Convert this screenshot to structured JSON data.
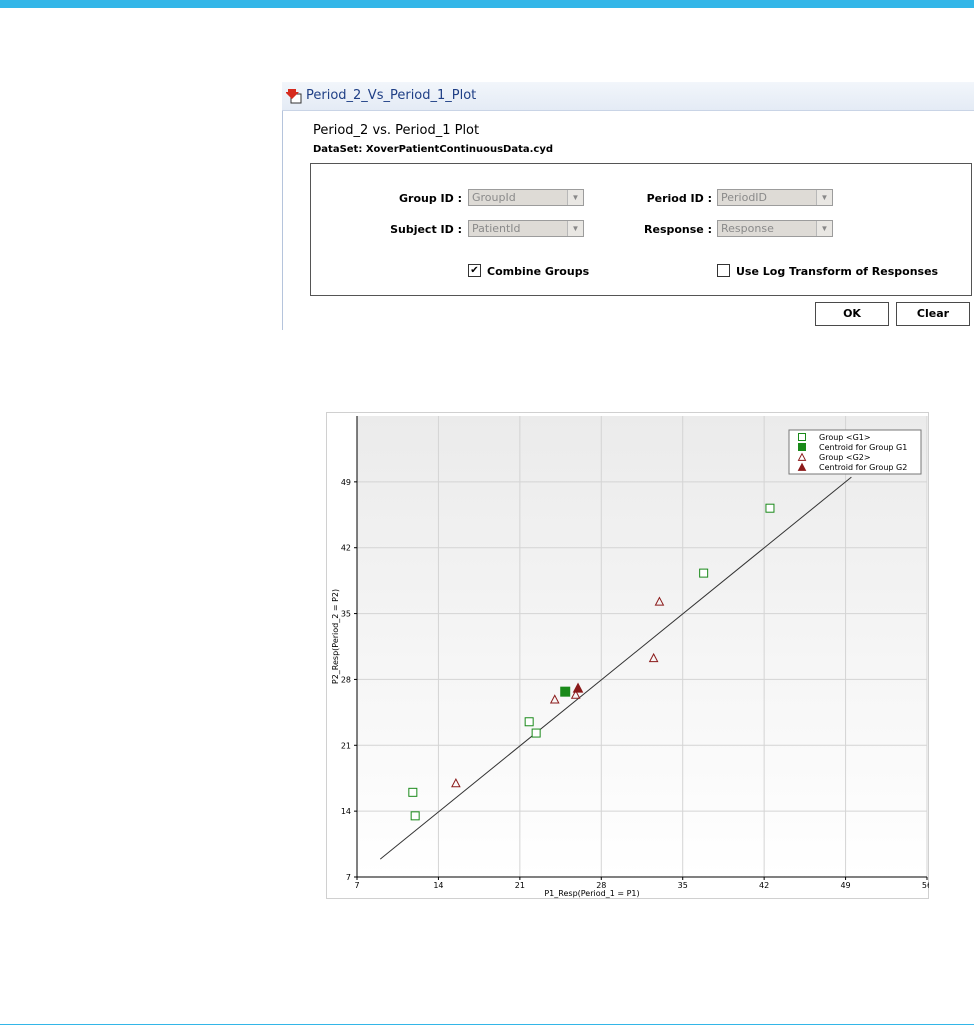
{
  "dialog": {
    "title": "Period_2_Vs_Period_1_Plot",
    "heading": "Period_2 vs. Period_1 Plot",
    "dataset": "DataSet: XoverPatientContinuousData.cyd"
  },
  "form": {
    "group_id": {
      "label": "Group ID :",
      "value": "GroupId"
    },
    "subject_id": {
      "label": "Subject ID :",
      "value": "PatientId"
    },
    "period_id": {
      "label": "Period ID :",
      "value": "PeriodID"
    },
    "response": {
      "label": "Response :",
      "value": "Response"
    },
    "combine_groups": {
      "label": "Combine Groups",
      "checked": true,
      "mark": "✔"
    },
    "log_transform": {
      "label": "Use Log Transform of Responses",
      "checked": false,
      "mark": ""
    }
  },
  "buttons": {
    "ok": "OK",
    "clear": "Clear"
  },
  "icons": {
    "title": "red-down-arrow-icon",
    "dropdown": "chevron-down-icon"
  },
  "colors": {
    "accent": "#33b6e8",
    "g1": "#1a8a1a",
    "g2": "#8b1a1a",
    "title": "#1f3f86"
  },
  "chart_data": {
    "type": "scatter",
    "xlabel": "P1_Resp(Period_1 = P1)",
    "ylabel": "P2_Resp(Period_2 = P2)",
    "xlim": [
      7,
      56
    ],
    "ylim": [
      7,
      56
    ],
    "xticks": [
      7,
      14,
      21,
      28,
      35,
      42,
      49,
      56
    ],
    "yticks": [
      7,
      14,
      21,
      28,
      35,
      42,
      49
    ],
    "grid": true,
    "legend_position": "top-right",
    "series": [
      {
        "name": "Group <G1>",
        "marker": "open-square",
        "color": "#1a8a1a",
        "points": [
          [
            11.8,
            16.0
          ],
          [
            12.0,
            13.5
          ],
          [
            21.8,
            23.5
          ],
          [
            22.4,
            22.3
          ],
          [
            36.8,
            39.3
          ],
          [
            42.5,
            46.2
          ]
        ]
      },
      {
        "name": "Centroid for Group G1",
        "marker": "filled-square",
        "color": "#1a8a1a",
        "points": [
          [
            24.9,
            26.7
          ]
        ]
      },
      {
        "name": "Group <G2>",
        "marker": "open-triangle",
        "color": "#8b1a1a",
        "points": [
          [
            15.5,
            17.0
          ],
          [
            24.0,
            25.9
          ],
          [
            25.8,
            26.4
          ],
          [
            32.5,
            30.3
          ],
          [
            33.0,
            36.3
          ]
        ]
      },
      {
        "name": "Centroid for Group G2",
        "marker": "filled-triangle",
        "color": "#8b1a1a",
        "points": [
          [
            26.0,
            27.1
          ]
        ]
      }
    ],
    "reference_line": [
      [
        9,
        8.9
      ],
      [
        49.5,
        49.5
      ]
    ]
  }
}
